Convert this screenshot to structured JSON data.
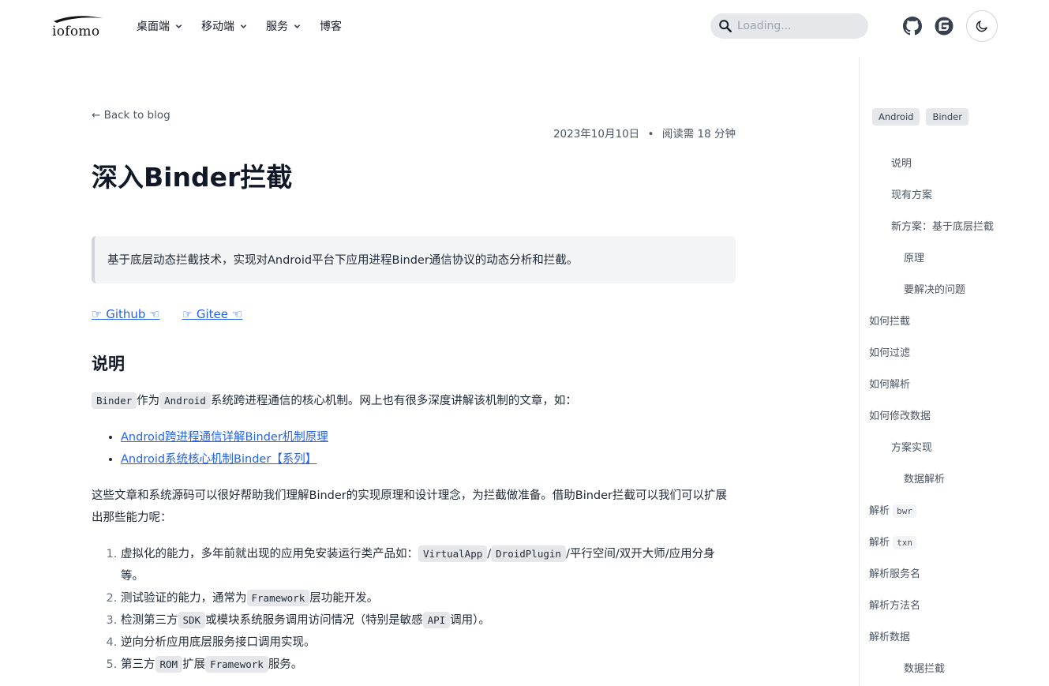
{
  "header": {
    "logo_text": "iofomo",
    "nav": [
      {
        "label": "桌面端"
      },
      {
        "label": "移动端"
      },
      {
        "label": "服务"
      },
      {
        "label": "博客"
      }
    ],
    "search_placeholder": "Loading...",
    "icons": [
      "github-icon",
      "gitee-icon",
      "moon-icon"
    ]
  },
  "article": {
    "back_link": "← Back to blog",
    "date": "2023年10月10日",
    "separator": "•",
    "read_time": "阅读需 18 分钟",
    "title": "深入Binder拦截",
    "quote": "基于底层动态拦截技术，实现对Android平台下应用进程Binder通信协议的动态分析和拦截。",
    "links": [
      "☞ Github ☜",
      "☞ Gitee ☜"
    ],
    "section_heading": "说明",
    "intro": {
      "code1": "Binder",
      "text1": "作为",
      "code2": "Android",
      "text2": "系统跨进程通信的核心机制。网上也有很多深度讲解该机制的文章，如："
    },
    "ref_links": [
      "Android跨进程通信详解Binder机制原理",
      "Android系统核心机制Binder【系列】"
    ],
    "para2": "这些文章和系统源码可以很好帮助我们理解Binder的实现原理和设计理念，为拦截做准备。借助Binder拦截可以我们可以扩展出那些能力呢：",
    "list": {
      "i1_text": "虚拟化的能力，多年前就出现的应用免安装运行类产品如：",
      "i1_code1": "VirtualApp",
      "i1_sep": "/",
      "i1_code2": "DroidPlugin",
      "i1_tail": "/平行空间/双开大师/应用分身等。",
      "i2_text": "测试验证的能力，通常为",
      "i2_code": "Framework",
      "i2_tail": "层功能开发。",
      "i3_text": "检测第三方",
      "i3_code1": "SDK",
      "i3_mid": "或模块系统服务调用访问情况（特别是敏感",
      "i3_code2": "API",
      "i3_tail": "调用）。",
      "i4_text": "逆向分析应用底层服务接口调用实现。",
      "i5_text": "第三方",
      "i5_code1": "ROM",
      "i5_mid": "扩展",
      "i5_code2": "Framework",
      "i5_tail": "服务。"
    }
  },
  "sidebar": {
    "tags": [
      "Android",
      "Binder"
    ],
    "toc": [
      {
        "label": "说明"
      },
      {
        "label": "现有方案"
      },
      {
        "label": "新方案：基于底层拦截"
      },
      {
        "label": "原理"
      },
      {
        "label": "要解决的问题"
      },
      {
        "label": "如何拦截"
      },
      {
        "label": "如何过滤"
      },
      {
        "label": "如何解析"
      },
      {
        "label": "如何修改数据"
      },
      {
        "label": "方案实现"
      },
      {
        "label": "数据解析"
      },
      {
        "label": "解析",
        "code": "bwr"
      },
      {
        "label": "解析",
        "code": "txn"
      },
      {
        "label": "解析服务名"
      },
      {
        "label": "解析方法名"
      },
      {
        "label": "解析数据"
      },
      {
        "label": "数据拦截"
      }
    ]
  },
  "colors": {
    "link": "#2563eb",
    "code_bg": "#e5e7eb",
    "quote_bg": "#f3f4f6",
    "quote_border": "#d1d5db",
    "text": "#1f2937"
  }
}
